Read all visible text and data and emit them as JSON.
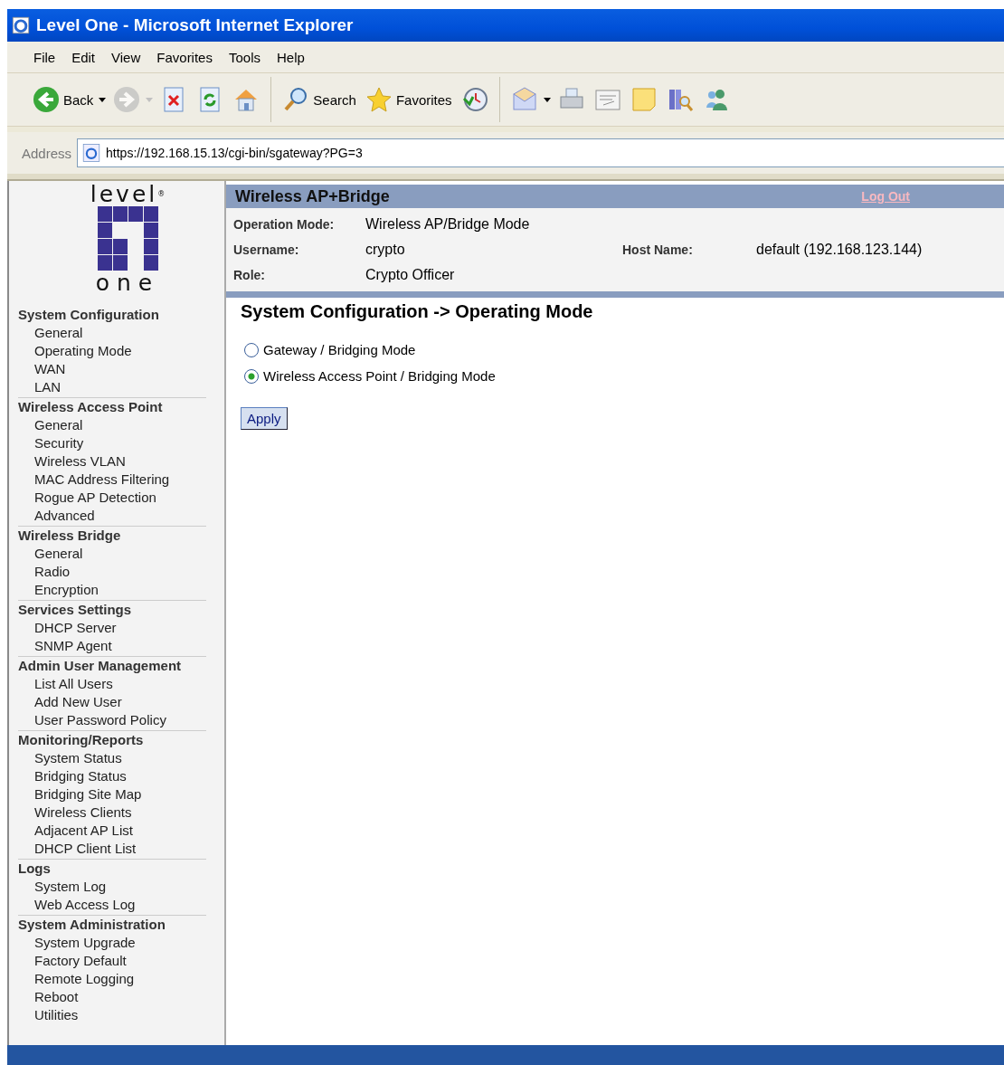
{
  "window": {
    "title": "Level One - Microsoft Internet Explorer"
  },
  "menu": [
    "File",
    "Edit",
    "View",
    "Favorites",
    "Tools",
    "Help"
  ],
  "toolbar": [
    {
      "kind": "back",
      "label": "Back",
      "dropdown": true
    },
    {
      "kind": "forward",
      "dropdown": true,
      "disabled": true
    },
    {
      "kind": "stop"
    },
    {
      "kind": "refresh"
    },
    {
      "kind": "home"
    },
    {
      "kind": "sep"
    },
    {
      "kind": "search",
      "label": "Search"
    },
    {
      "kind": "favorites",
      "label": "Favorites"
    },
    {
      "kind": "history"
    },
    {
      "kind": "sep"
    },
    {
      "kind": "mail",
      "dropdown": true
    },
    {
      "kind": "print"
    },
    {
      "kind": "edit"
    },
    {
      "kind": "note"
    },
    {
      "kind": "research"
    },
    {
      "kind": "messenger"
    }
  ],
  "address": {
    "label": "Address",
    "url": "https://192.168.15.13/cgi-bin/sgateway?PG=3"
  },
  "logo": {
    "top": "level",
    "mark": "®",
    "bottom": "one"
  },
  "sidebar": [
    {
      "heading": "System Configuration",
      "items": [
        "General",
        "Operating Mode",
        "WAN",
        "LAN"
      ]
    },
    {
      "heading": "Wireless Access Point",
      "items": [
        "General",
        "Security",
        "Wireless VLAN",
        "MAC Address Filtering",
        "Rogue AP Detection",
        "Advanced"
      ]
    },
    {
      "heading": "Wireless Bridge",
      "items": [
        "General",
        "Radio",
        "Encryption"
      ]
    },
    {
      "heading": "Services Settings",
      "items": [
        "DHCP Server",
        "SNMP Agent"
      ]
    },
    {
      "heading": "Admin User Management",
      "items": [
        "List All Users",
        "Add New User",
        "User Password Policy"
      ]
    },
    {
      "heading": "Monitoring/Reports",
      "items": [
        "System Status",
        "Bridging Status",
        "Bridging Site Map",
        "Wireless Clients",
        "Adjacent AP List",
        "DHCP Client List"
      ]
    },
    {
      "heading": "Logs",
      "items": [
        "System Log",
        "Web Access Log"
      ]
    },
    {
      "heading": "System Administration",
      "items": [
        "System Upgrade",
        "Factory Default",
        "Remote Logging",
        "Reboot",
        "Utilities"
      ]
    }
  ],
  "header": {
    "title": "Wireless AP+Bridge",
    "logout": "Log Out",
    "info": [
      [
        {
          "label": "Operation Mode:",
          "value": "Wireless AP/Bridge Mode"
        }
      ],
      [
        {
          "label": "Username:",
          "value": "crypto"
        },
        {
          "label": "Host Name:",
          "value": "default (192.168.123.144)"
        }
      ],
      [
        {
          "label": "Role:",
          "value": "Crypto Officer"
        }
      ]
    ]
  },
  "page": {
    "heading": "System Configuration -> Operating Mode",
    "options": [
      {
        "label": "Gateway / Bridging Mode",
        "selected": false
      },
      {
        "label": "Wireless Access Point / Bridging Mode",
        "selected": true
      }
    ],
    "button": "Apply"
  }
}
